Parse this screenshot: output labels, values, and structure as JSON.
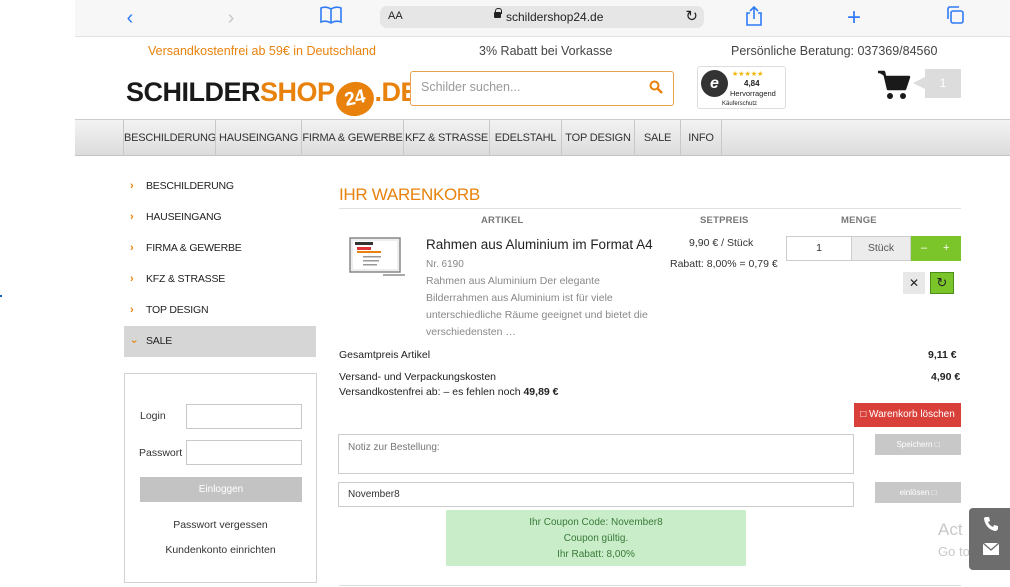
{
  "browser": {
    "text_size": "AA",
    "url": "schildershop24.de"
  },
  "topbar": {
    "shipping": "Versandkostenfrei ab 59€ in Deutschland",
    "discount": "3% Rabatt bei Vorkasse",
    "consulting": "Persönliche Beratung: 037369/84560"
  },
  "logo": {
    "part1": "SCHILDER",
    "part2": "SHOP",
    "badge": "24",
    "part3": ".DE"
  },
  "search": {
    "placeholder": "Schilder suchen..."
  },
  "trust": {
    "stars": "★★★★★",
    "score": "4,84",
    "rating": "Hervorragend",
    "label": "Käuferschutz"
  },
  "cart": {
    "count": "1"
  },
  "mainnav": [
    "BESCHILDERUNG",
    "HAUSEINGANG",
    "FIRMA & GEWERBE",
    "KFZ & STRASSE",
    "EDELSTAHL",
    "TOP DESIGN",
    "SALE",
    "INFO"
  ],
  "sidebar": {
    "categories": [
      "BESCHILDERUNG",
      "HAUSEINGANG",
      "FIRMA & GEWERBE",
      "KFZ & STRASSE",
      "TOP DESIGN",
      "SALE"
    ],
    "login_label": "Login",
    "password_label": "Passwort",
    "login_button": "Einloggen",
    "forgot_link": "Passwort vergessen",
    "register_link": "Kundenkonto einrichten"
  },
  "cart_page": {
    "title": "IHR WARENKORB",
    "col_article": "ARTIKEL",
    "col_price": "SETPREIS",
    "col_qty": "MENGE",
    "item": {
      "name": "Rahmen aus Aluminium im Format A4",
      "number": "Nr. 6190",
      "description": "Rahmen aus Aluminium Der elegante Bilderrahmen aus Aluminium ist für viele unterschiedliche Räume geeignet und bietet die verschiedensten …",
      "unit_price": "9,90 € / Stück",
      "discount": "Rabatt: 8,00% = 0,79 €",
      "quantity": "1",
      "unit": "Stück",
      "minus": "–",
      "plus": "+"
    },
    "total_label": "Gesamtpreis Artikel",
    "total_value": "9,11 €",
    "shipping_label": "Versand- und Verpackungskosten",
    "shipping_value": "4,90 €",
    "free_shipping_prefix": "Versandkostenfrei ab: – es fehlen noch",
    "free_shipping_amount": "49,89 €",
    "clear_button": "□ Warenkorb löschen",
    "note_placeholder": "Notiz zur Bestellung:",
    "save_button": "Speichern □",
    "coupon_value": "November8",
    "redeem_button": "einlösen □",
    "coupon_line1": "Ihr Coupon Code: November8",
    "coupon_line2": "Coupon gültig.",
    "coupon_line3": "Ihr Rabatt: 8,00%"
  },
  "overlay": {
    "line1": "Act",
    "line2": "Go to"
  }
}
